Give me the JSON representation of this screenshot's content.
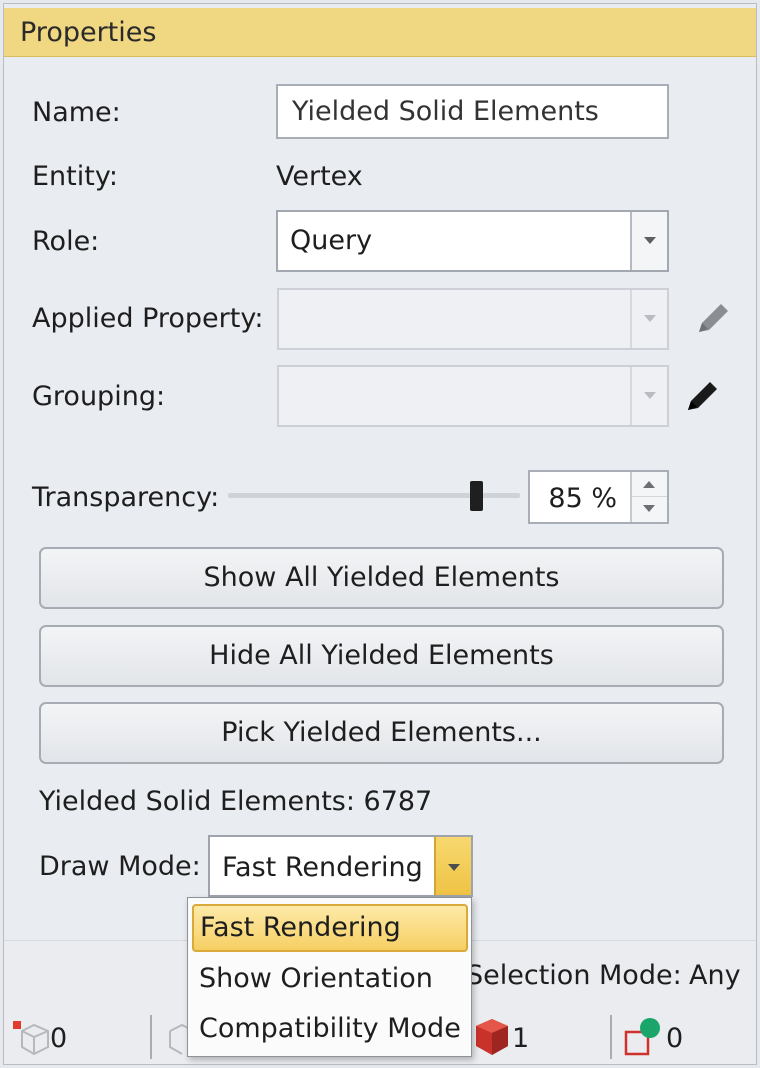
{
  "panel": {
    "title": "Properties"
  },
  "form": {
    "name_label": "Name:",
    "name_value": "Yielded Solid Elements",
    "entity_label": "Entity:",
    "entity_value": "Vertex",
    "role_label": "Role:",
    "role_value": "Query",
    "applied_property_label": "Applied Property:",
    "applied_property_value": "",
    "grouping_label": "Grouping:",
    "grouping_value": "",
    "transparency_label": "Transparency:",
    "transparency_value": "85 %",
    "transparency_level": 0.85
  },
  "actions": {
    "show_all": "Show All Yielded Elements",
    "hide_all": "Hide All Yielded Elements",
    "pick": "Pick Yielded Elements..."
  },
  "summary": {
    "yielded_count_text": "Yielded Solid Elements: 6787"
  },
  "draw_mode": {
    "label": "Draw Mode:",
    "value": "Fast Rendering",
    "options": [
      "Fast Rendering",
      "Show Orientation",
      "Compatibility Mode"
    ]
  },
  "statusbar": {
    "selection_mode_label": "Selection Mode:",
    "selection_mode_value": "Any",
    "vertex_count": "0",
    "solid_count": "1",
    "other_count": "0"
  },
  "colors": {
    "header": "#f0d781",
    "dropdown_highlight": "#f6cf63",
    "accent_red": "#d0312d"
  }
}
